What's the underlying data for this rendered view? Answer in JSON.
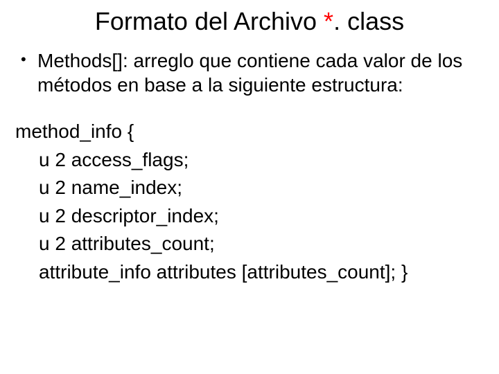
{
  "title_parts": {
    "before": "Formato del Archivo ",
    "star": "*",
    "after": ". class"
  },
  "bullet": "Methods[]: arreglo que contiene cada valor de los métodos en base a la siguiente estructura:",
  "code": {
    "l0": "method_info {",
    "l1": "u 2 access_flags;",
    "l2": "u 2 name_index;",
    "l3": "u 2 descriptor_index;",
    "l4": "u 2 attributes_count;",
    "l5": "attribute_info attributes [attributes_count];    }"
  }
}
